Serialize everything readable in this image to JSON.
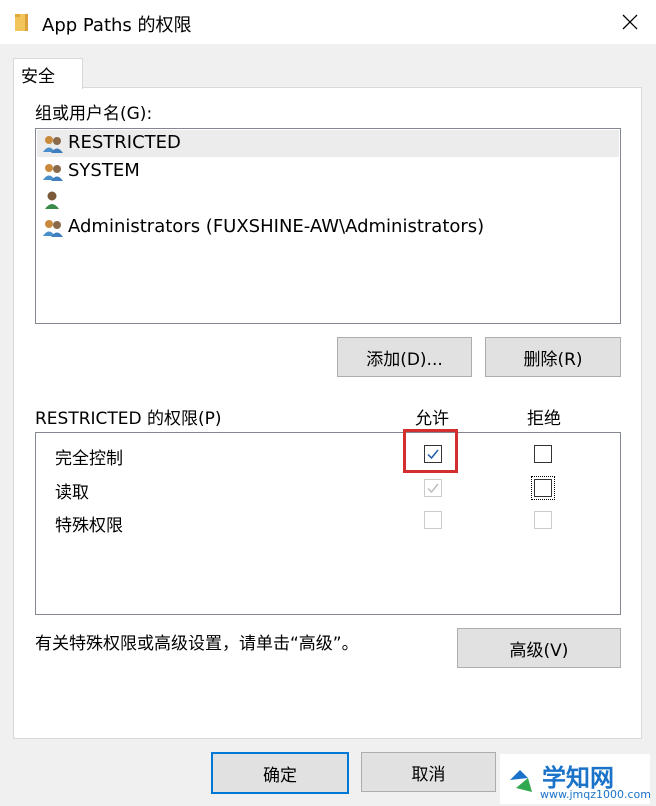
{
  "window": {
    "title": "App Paths 的权限"
  },
  "tabs": [
    {
      "label": "安全"
    }
  ],
  "groups": {
    "label": "组或用户名(G):",
    "items": [
      {
        "name": "RESTRICTED",
        "icon": "users-group-icon",
        "selected": true
      },
      {
        "name": "SYSTEM",
        "icon": "users-group-icon"
      },
      {
        "name": "",
        "icon": "user-icon"
      },
      {
        "name": "Administrators (FUXSHINE-AW\\Administrators)",
        "icon": "users-group-icon"
      }
    ]
  },
  "buttons": {
    "add": "添加(D)...",
    "remove": "删除(R)",
    "advanced": "高级(V)"
  },
  "permissions": {
    "label": "RESTRICTED 的权限(P)",
    "allow_header": "允许",
    "deny_header": "拒绝",
    "rows": [
      {
        "name": "完全控制",
        "allow": true,
        "allow_disabled": false,
        "deny": false,
        "deny_disabled": false
      },
      {
        "name": "读取",
        "allow": true,
        "allow_disabled": true,
        "deny": false,
        "deny_disabled": false
      },
      {
        "name": "特殊权限",
        "allow": false,
        "allow_disabled": true,
        "deny": false,
        "deny_disabled": true
      }
    ]
  },
  "advanced_hint": "有关特殊权限或高级设置，请单击“高级”。",
  "footer": {
    "ok": "确定",
    "cancel": "取消"
  },
  "watermark": {
    "text": "学知网",
    "url": "www.jmqz1000.com"
  },
  "colors": {
    "highlight": "#d32f2f",
    "accent": "#0078d7",
    "watermark": "#1a73c9"
  }
}
